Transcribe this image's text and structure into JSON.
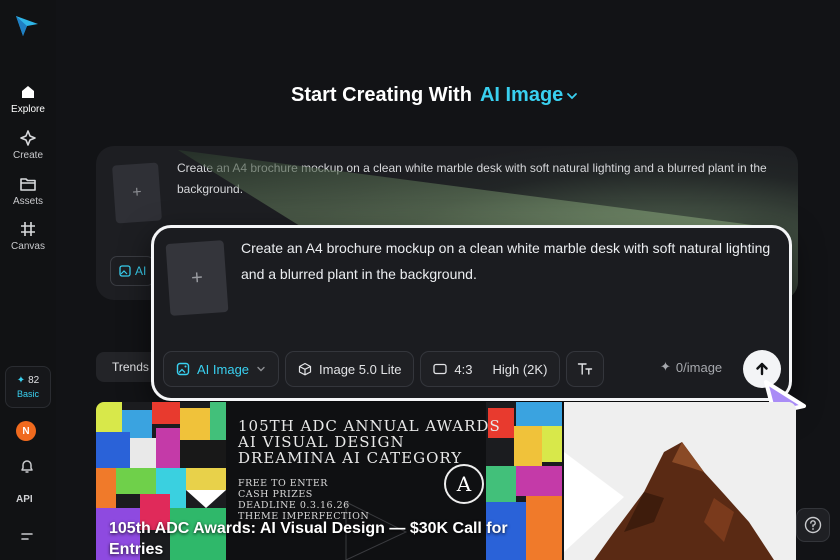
{
  "sidebar": {
    "items": [
      {
        "label": "Explore",
        "icon": "home-icon"
      },
      {
        "label": "Create",
        "icon": "sparkle-icon"
      },
      {
        "label": "Assets",
        "icon": "folder-icon"
      },
      {
        "label": "Canvas",
        "icon": "hash-grid-icon"
      }
    ],
    "credits": {
      "count": "82",
      "plan": "Basic"
    },
    "avatar_initial": "N",
    "api_label": "API"
  },
  "header": {
    "prefix": "Start Creating With",
    "mode": "AI Image"
  },
  "back_card": {
    "prompt": "Create an A4 brochure mockup on a clean white marble desk with soft natural lighting and a blurred plant in the background.",
    "chip_label": "AI"
  },
  "trends_tab": "Trends",
  "composer": {
    "prompt": "Create an A4 brochure mockup on a clean white marble desk with soft natural lighting and a blurred plant in the background.",
    "mode_chip": "AI Image",
    "model_chip": "Image 5.0 Lite",
    "ratio": "4:3",
    "quality": "High (2K)",
    "cost": "0/image"
  },
  "gallery": {
    "poster_lines": [
      "105TH ADC ANNUAL AWARDS",
      "AI VISUAL DESIGN",
      "DREAMINA AI CATEGORY"
    ],
    "poster_small": [
      "FREE TO ENTER",
      "CASH PRIZES",
      "DEADLINE 0.3.16.26",
      "THEME IMPERFECTION"
    ],
    "caption": "105th ADC Awards: AI Visual Design — $30K Call for Entries"
  },
  "colors": {
    "accent": "#39d0f0",
    "background": "#121316",
    "avatar": "#f06a1e"
  }
}
